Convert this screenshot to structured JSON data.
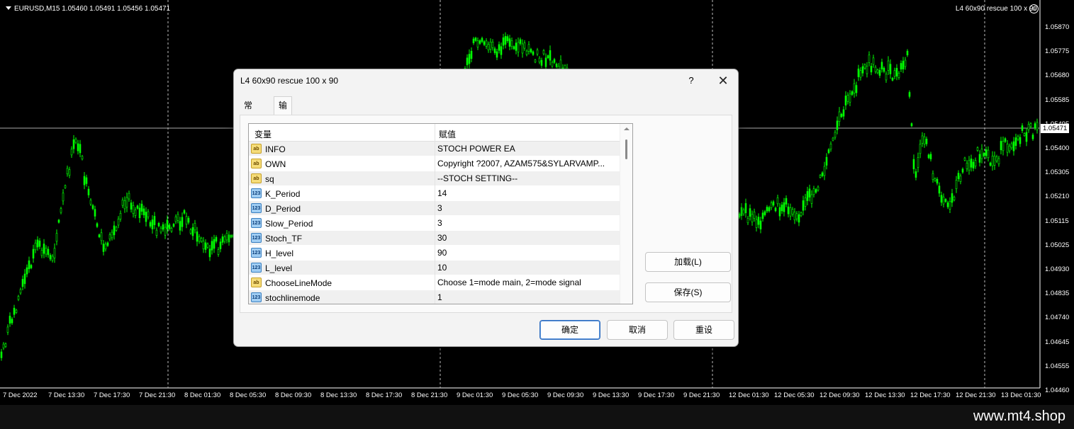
{
  "chart": {
    "symbol_info": "EURUSD,M15  1.05460 1.05491 1.05456 1.05471",
    "ea_label": "L4 60x90 rescue 100 x 90",
    "current_price": "1.05471",
    "price_labels": [
      "1.05870",
      "1.05775",
      "1.05680",
      "1.05585",
      "1.05495",
      "1.05400",
      "1.05305",
      "1.05210",
      "1.05115",
      "1.05025",
      "1.04930",
      "1.04835",
      "1.04740",
      "1.04645",
      "1.04555",
      "1.04460"
    ],
    "time_labels": [
      "7 Dec 2022",
      "7 Dec 13:30",
      "7 Dec 17:30",
      "7 Dec 21:30",
      "8 Dec 01:30",
      "8 Dec 05:30",
      "8 Dec 09:30",
      "8 Dec 13:30",
      "8 Dec 17:30",
      "8 Dec 21:30",
      "9 Dec 01:30",
      "9 Dec 05:30",
      "9 Dec 09:30",
      "9 Dec 13:30",
      "9 Dec 17:30",
      "9 Dec 21:30",
      "12 Dec 01:30",
      "12 Dec 05:30",
      "12 Dec 09:30",
      "12 Dec 13:30",
      "12 Dec 17:30",
      "12 Dec 21:30",
      "13 Dec 01:30"
    ],
    "candle_color": "#00ff00",
    "background": "#000000"
  },
  "dialog": {
    "title": "L4 60x90 rescue 100 x 90",
    "help": "?",
    "close": "✕",
    "tabs": [
      "常用",
      "输入参数"
    ],
    "grid": {
      "col_variable": "变量",
      "col_value": "赋值",
      "rows": [
        {
          "type": "ab",
          "name": "INFO",
          "value": "STOCH POWER EA"
        },
        {
          "type": "ab",
          "name": "OWN",
          "value": "Copyright ?2007, AZAM575&SYLARVAMP..."
        },
        {
          "type": "ab",
          "name": "sq",
          "value": "--STOCH SETTING--"
        },
        {
          "type": "123",
          "name": "K_Period",
          "value": "14"
        },
        {
          "type": "123",
          "name": "D_Period",
          "value": "3"
        },
        {
          "type": "123",
          "name": "Slow_Period",
          "value": "3"
        },
        {
          "type": "123",
          "name": "Stoch_TF",
          "value": "30"
        },
        {
          "type": "123",
          "name": "H_level",
          "value": "90"
        },
        {
          "type": "123",
          "name": "L_level",
          "value": "10"
        },
        {
          "type": "ab",
          "name": "ChooseLineMode",
          "value": "Choose 1=mode main, 2=mode signal"
        },
        {
          "type": "123",
          "name": "stochlinemode",
          "value": "1"
        }
      ]
    },
    "load_label": "加载(L)",
    "save_label": "保存(S)",
    "ok_label": "确定",
    "cancel_label": "取消",
    "reset_label": "重设"
  },
  "footer": {
    "site": "www.mt4.shop"
  }
}
